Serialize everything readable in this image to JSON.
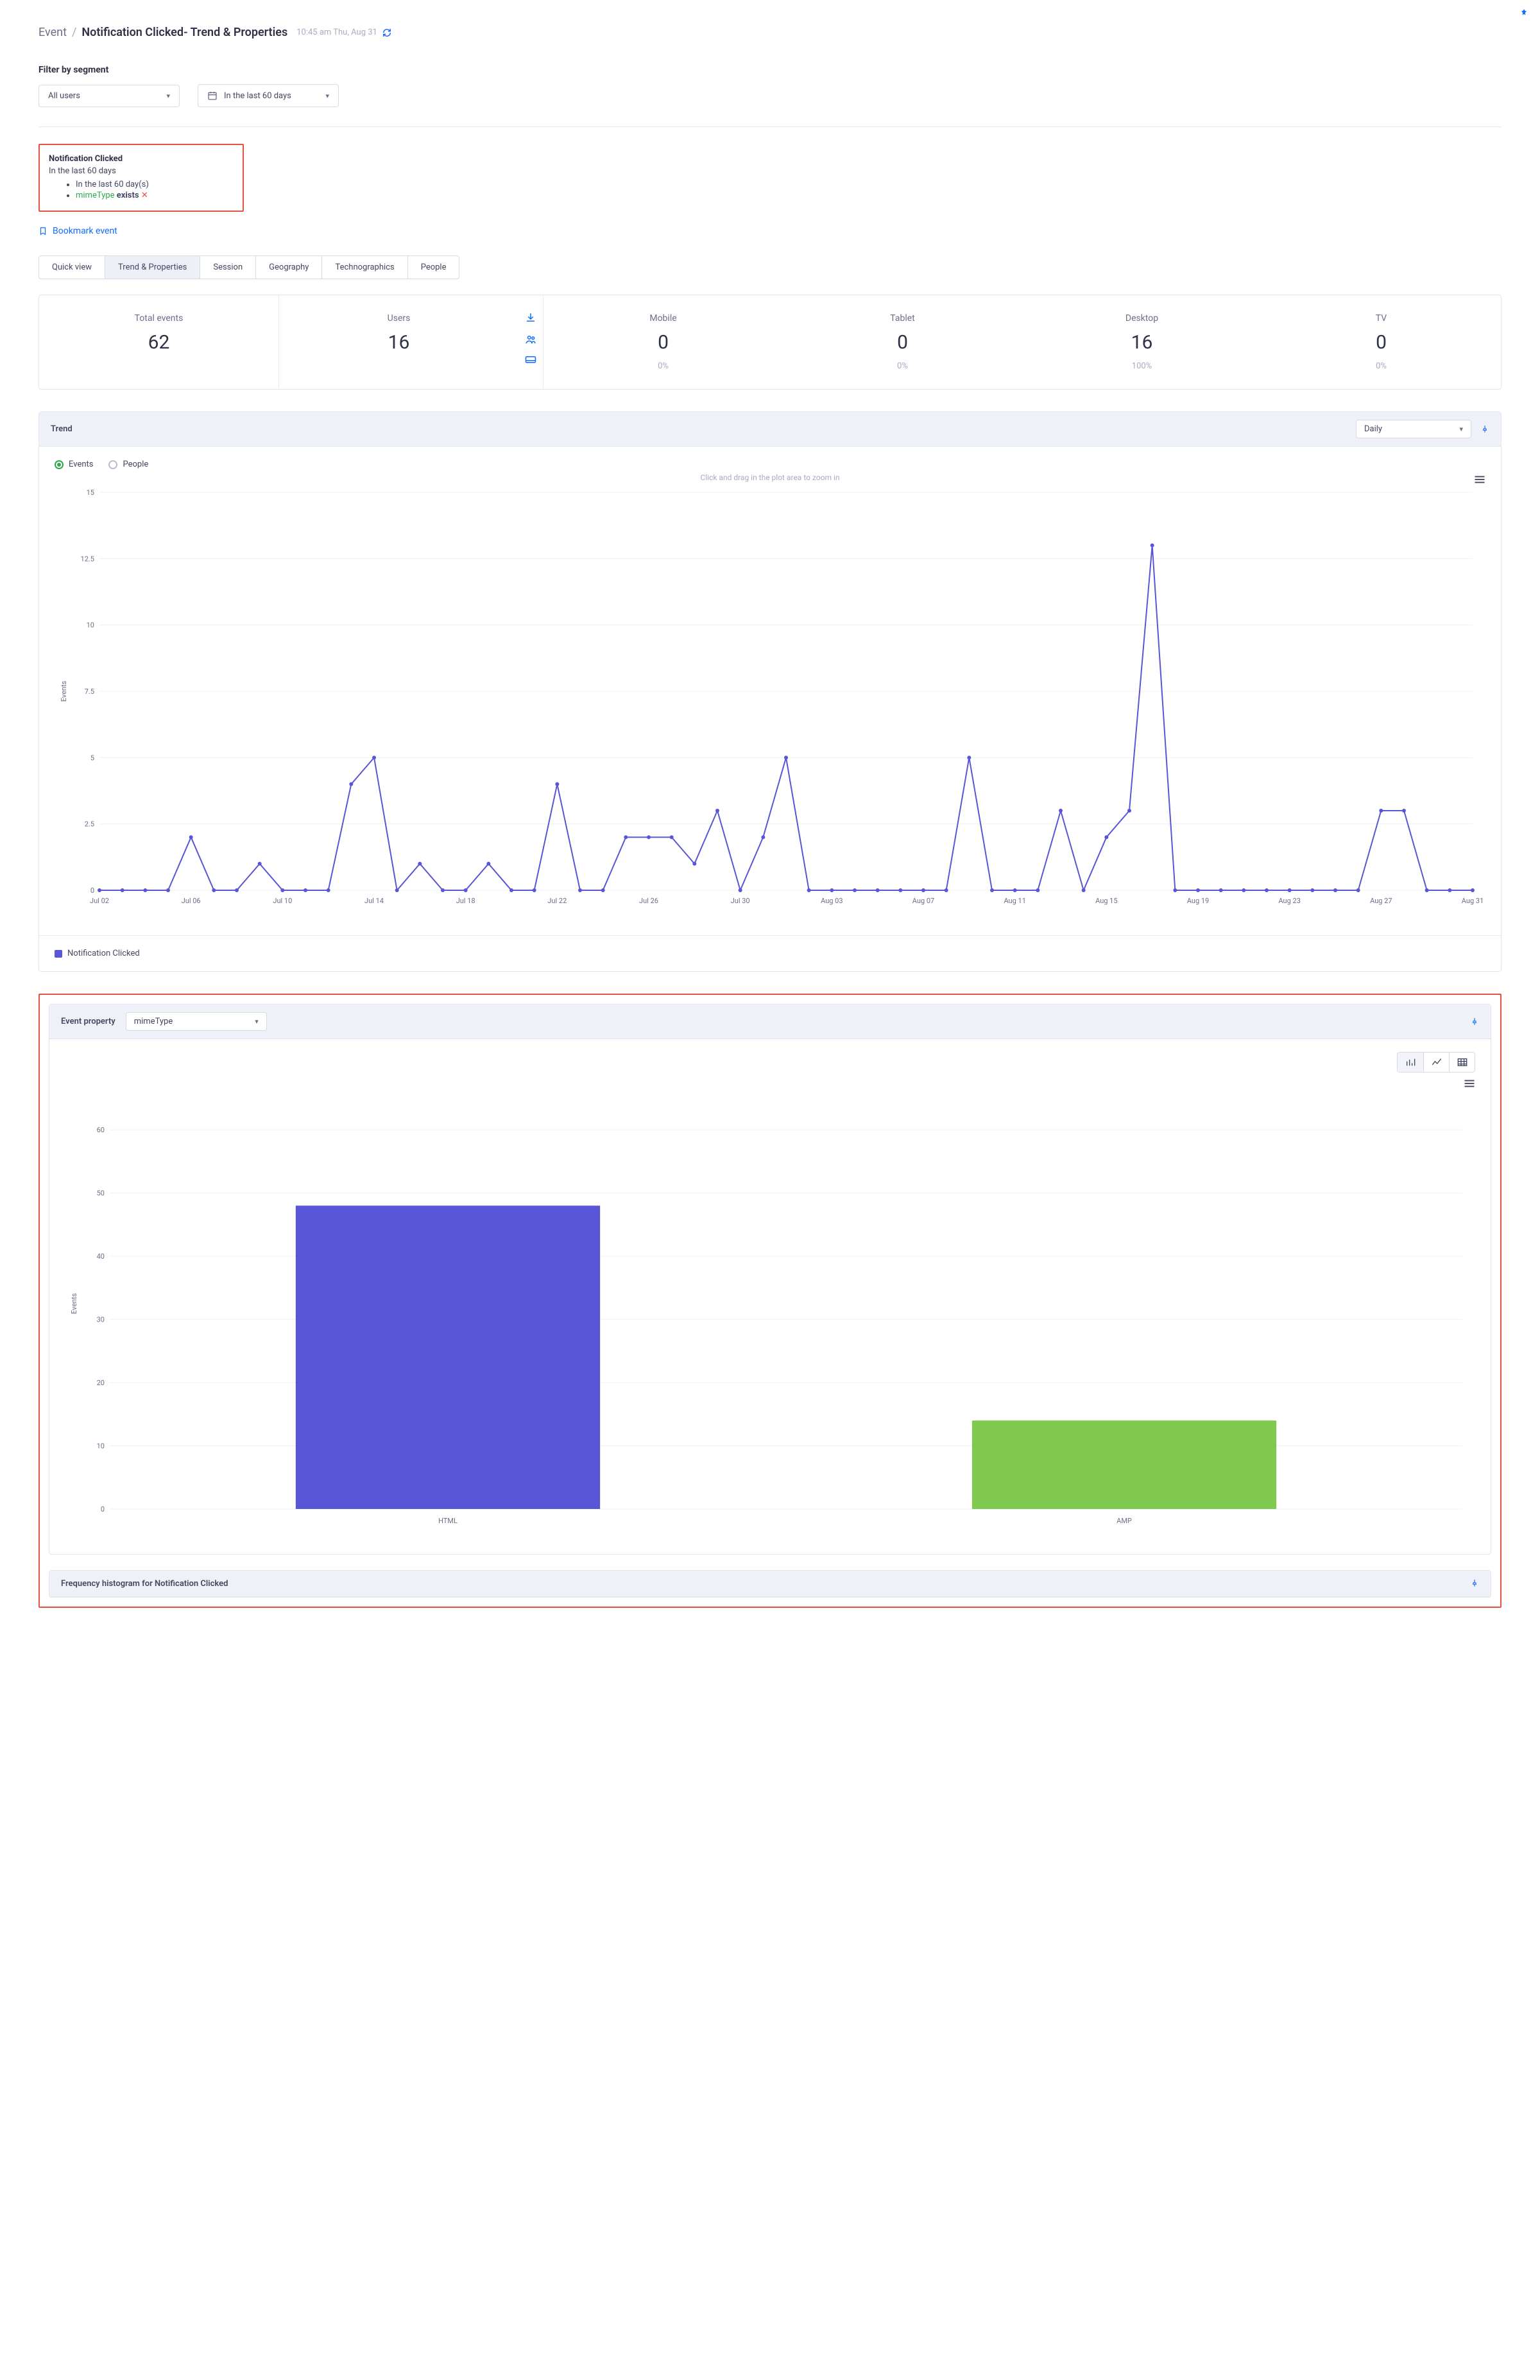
{
  "breadcrumb": {
    "root": "Event",
    "current": "Notification Clicked- Trend & Properties",
    "timestamp": "10:45 am Thu, Aug 31"
  },
  "filter": {
    "label": "Filter by segment",
    "segment": "All users",
    "date_range": "In the last 60 days"
  },
  "callout": {
    "title": "Notification Clicked",
    "subtitle": "In the last 60 days",
    "item1": "In the last 60 day(s)",
    "item2_prop": "mimeType",
    "item2_op": "exists"
  },
  "bookmark_label": "Bookmark event",
  "tabs": [
    "Quick view",
    "Trend & Properties",
    "Session",
    "Geography",
    "Technographics",
    "People"
  ],
  "active_tab": 1,
  "stats": {
    "total_label": "Total events",
    "total_value": "62",
    "users_label": "Users",
    "users_value": "16",
    "mobile_label": "Mobile",
    "mobile_value": "0",
    "mobile_pct": "0%",
    "tablet_label": "Tablet",
    "tablet_value": "0",
    "tablet_pct": "0%",
    "desktop_label": "Desktop",
    "desktop_value": "16",
    "desktop_pct": "100%",
    "tv_label": "TV",
    "tv_value": "0",
    "tv_pct": "0%"
  },
  "trend": {
    "title": "Trend",
    "granularity": "Daily",
    "radio_events": "Events",
    "radio_people": "People",
    "hint": "Click and drag in the plot area to zoom in",
    "legend": "Notification Clicked",
    "y_title": "Events"
  },
  "event_prop": {
    "title": "Event property",
    "selected": "mimeType",
    "y_title": "Events"
  },
  "freq": {
    "title": "Frequency histogram for Notification Clicked"
  },
  "colors": {
    "primary": "#5856d6",
    "green_bar": "#7ec94e",
    "link": "#126bff",
    "red": "#e15241"
  },
  "chart_data": [
    {
      "type": "line",
      "title": "Trend",
      "ylabel": "Events",
      "ylim": [
        0,
        15
      ],
      "yticks": [
        0,
        2.5,
        5,
        7.5,
        10,
        12.5,
        15
      ],
      "xticks": [
        "Jul 02",
        "Jul 06",
        "Jul 10",
        "Jul 14",
        "Jul 18",
        "Jul 22",
        "Jul 26",
        "Jul 30",
        "Aug 03",
        "Aug 07",
        "Aug 11",
        "Aug 15",
        "Aug 19",
        "Aug 23",
        "Aug 27",
        "Aug 31"
      ],
      "series": [
        {
          "name": "Notification Clicked",
          "color": "#5856d6",
          "x": [
            "Jul 02",
            "Jul 03",
            "Jul 04",
            "Jul 05",
            "Jul 06",
            "Jul 07",
            "Jul 08",
            "Jul 09",
            "Jul 10",
            "Jul 11",
            "Jul 12",
            "Jul 13",
            "Jul 14",
            "Jul 15",
            "Jul 16",
            "Jul 17",
            "Jul 18",
            "Jul 19",
            "Jul 20",
            "Jul 21",
            "Jul 22",
            "Jul 23",
            "Jul 24",
            "Jul 25",
            "Jul 26",
            "Jul 27",
            "Jul 28",
            "Jul 29",
            "Jul 30",
            "Jul 31",
            "Aug 01",
            "Aug 02",
            "Aug 03",
            "Aug 04",
            "Aug 05",
            "Aug 06",
            "Aug 07",
            "Aug 08",
            "Aug 09",
            "Aug 10",
            "Aug 11",
            "Aug 12",
            "Aug 13",
            "Aug 14",
            "Aug 15",
            "Aug 16",
            "Aug 17",
            "Aug 18",
            "Aug 19",
            "Aug 20",
            "Aug 21",
            "Aug 22",
            "Aug 23",
            "Aug 24",
            "Aug 25",
            "Aug 26",
            "Aug 27",
            "Aug 28",
            "Aug 29",
            "Aug 30",
            "Aug 31"
          ],
          "values": [
            0,
            0,
            0,
            0,
            2,
            0,
            0,
            1,
            0,
            0,
            0,
            4,
            5,
            0,
            1,
            0,
            0,
            1,
            0,
            0,
            4,
            0,
            0,
            2,
            2,
            2,
            1,
            3,
            0,
            2,
            5,
            0,
            0,
            0,
            0,
            0,
            0,
            0,
            5,
            0,
            0,
            0,
            3,
            0,
            2,
            3,
            13,
            0,
            0,
            0,
            0,
            0,
            0,
            0,
            0,
            0,
            3,
            3,
            0,
            0,
            0
          ]
        }
      ]
    },
    {
      "type": "bar",
      "title": "Event property: mimeType",
      "ylabel": "Events",
      "ylim": [
        0,
        65
      ],
      "yticks": [
        0,
        10,
        20,
        30,
        40,
        50,
        60
      ],
      "categories": [
        "HTML",
        "AMP"
      ],
      "values": [
        48,
        14
      ],
      "colors": [
        "#5856d6",
        "#7ec94e"
      ]
    }
  ]
}
